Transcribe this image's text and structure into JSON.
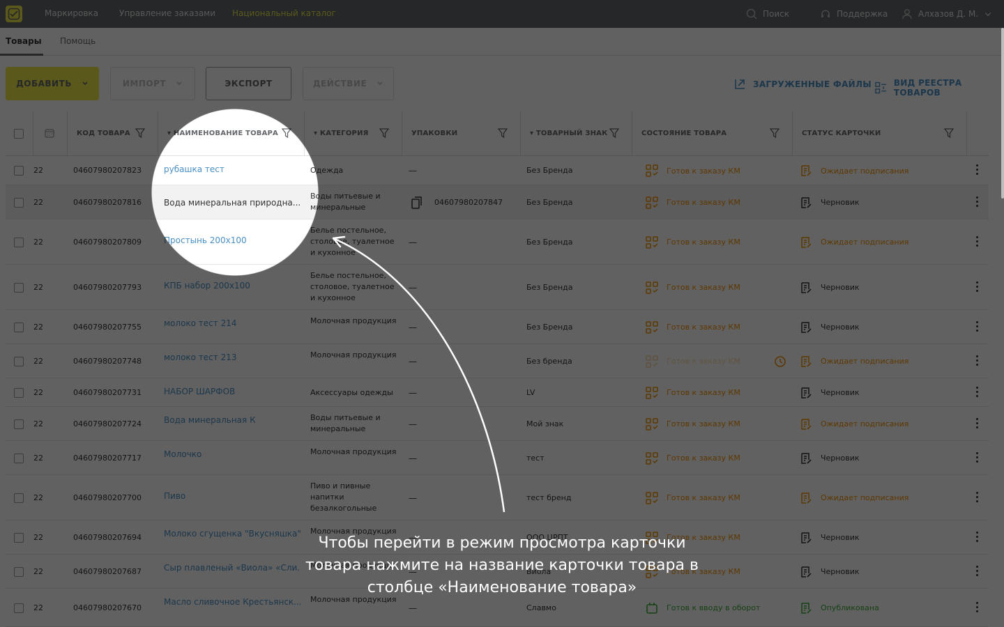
{
  "topbar": {
    "nav": [
      "Маркировка",
      "Управление заказами",
      "Национальный каталог"
    ],
    "search": "Поиск",
    "support": "Поддержка",
    "user": "Алхазов Д. М."
  },
  "subnav": [
    "Товары",
    "Помощь"
  ],
  "toolbar": {
    "add": "ДОБАВИТЬ",
    "import": "ИМПОРТ",
    "export": "ЭКСПОРТ",
    "action": "ДЕЙСТВИЕ",
    "files": "ЗАГРУЖЕННЫЕ ФАЙЛЫ",
    "view": "ВИД РЕЕСТРА ТОВАРОВ"
  },
  "columns": [
    "КОД ТОВАРА",
    "НАИМЕНОВАНИЕ ТОВАРА",
    "КАТЕГОРИЯ",
    "УПАКОВКИ",
    "ТОВАРНЫЙ ЗНАК",
    "СОСТОЯНИЕ ТОВАРА",
    "СТАТУС КАРТОЧКИ"
  ],
  "rows": [
    {
      "date": "22",
      "code": "04607980207823",
      "name": "рубашка тест",
      "category": "Одежда",
      "pack": "—",
      "brand": "Без Бренда",
      "state": "Готов к заказу КМ",
      "status": "Ожидает подписания"
    },
    {
      "date": "22",
      "code": "04607980207816",
      "name": "Вода минеральная природна...",
      "category": "Воды питьевые и минеральные",
      "pack": "04607980207847",
      "brand": "Без Бренда",
      "state": "Готов к заказу КМ",
      "status": "Черновик"
    },
    {
      "date": "22",
      "code": "04607980207809",
      "name": "Простынь 200х100",
      "category": "Белье постельное, столовое, туалетное и кухонное",
      "pack": "—",
      "brand": "Без Бренда",
      "state": "Готов к заказу КМ",
      "status": "Ожидает подписания"
    },
    {
      "date": "22",
      "code": "04607980207793",
      "name": "КПБ набор 200х100",
      "category": "Белье постельное, столовое, туалетное и кухонное",
      "pack": "—",
      "brand": "Без Бренда",
      "state": "Готов к заказу КМ",
      "status": "Черновик"
    },
    {
      "date": "22",
      "code": "04607980207755",
      "name": "молоко тест 214",
      "category": "Молочная продукция",
      "pack": "—",
      "brand": "Без Бренда",
      "state": "Готов к заказу КМ",
      "status": "Черновик"
    },
    {
      "date": "22",
      "code": "04607980207748",
      "name": "молоко тест 213",
      "category": "Молочная продукция",
      "pack": "—",
      "brand": "Без бренда",
      "state": "Готов к заказу КМ",
      "status": "Ожидает подписания"
    },
    {
      "date": "22",
      "code": "04607980207731",
      "name": "НАБОР ШАРФОВ",
      "category": "Аксессуары одежды",
      "pack": "—",
      "brand": "LV",
      "state": "Готов к заказу КМ",
      "status": "Черновик"
    },
    {
      "date": "22",
      "code": "04607980207724",
      "name": "Вода минеральная К",
      "category": "Воды питьевые и минеральные",
      "pack": "—",
      "brand": "Мой знак",
      "state": "Готов к заказу КМ",
      "status": "Ожидает подписания"
    },
    {
      "date": "22",
      "code": "04607980207717",
      "name": "Молочко",
      "category": "Молочная продукция",
      "pack": "—",
      "brand": "тест",
      "state": "Готов к заказу КМ",
      "status": "Черновик"
    },
    {
      "date": "22",
      "code": "04607980207700",
      "name": "Пиво",
      "category": "Пиво и пивные напитки безалкогольные",
      "pack": "—",
      "brand": "тест бренд",
      "state": "Готов к заказу КМ",
      "status": "Ожидает подписания"
    },
    {
      "date": "22",
      "code": "04607980207694",
      "name": "Молоко сгущенка \"Вкусняшка\"",
      "category": "Молочная продукция",
      "pack": "—",
      "brand": "ООО ЦРПТ",
      "state": "Готов к заказу КМ",
      "status": "Черновик"
    },
    {
      "date": "22",
      "code": "04607980207687",
      "name": "Сыр плавленый «Виола» «Сли...",
      "category": "Молочная продукция",
      "pack": "—",
      "brand": "Виола",
      "state": "Готов к заказу КМ",
      "status": "Черновик"
    },
    {
      "date": "22",
      "code": "04607980207670",
      "name": "Масло сливочное Крестьянск...",
      "category": "Молочная продукция",
      "pack": "—",
      "brand": "Славмо",
      "state": "Готов к вводу в оборот",
      "status": "Опубликована"
    }
  ],
  "caption": "Чтобы перейти в режим просмотра карточки товара нажмите на название карточки товара в столбце «Наименование товара»"
}
